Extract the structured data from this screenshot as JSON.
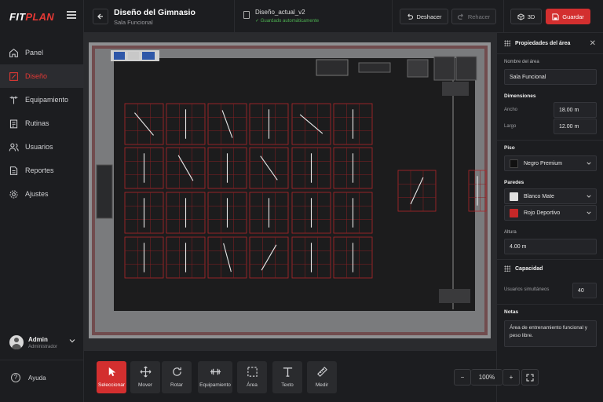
{
  "app": {
    "logo_a": "FIT",
    "logo_b": "PLAN"
  },
  "sidebar": {
    "items": [
      {
        "label": "Panel",
        "icon": "home-icon"
      },
      {
        "label": "Diseño",
        "icon": "design-icon"
      },
      {
        "label": "Equipamiento",
        "icon": "dumbbell-icon"
      },
      {
        "label": "Rutinas",
        "icon": "clipboard-icon"
      },
      {
        "label": "Usuarios",
        "icon": "users-icon"
      },
      {
        "label": "Reportes",
        "icon": "report-icon"
      },
      {
        "label": "Ajustes",
        "icon": "gear-icon"
      }
    ],
    "active": "Diseño",
    "user": {
      "name": "Admin",
      "role": "Administrador"
    },
    "help": "Ayuda"
  },
  "header": {
    "title": "Diseño del Gimnasio",
    "subtitle": "Sala Funcional",
    "file_name": "Diseño_actual_v2",
    "save_status": "Guardado automáticamente",
    "undo": "Deshacer",
    "redo": "Rehacer",
    "view3d": "3D",
    "save": "Guardar"
  },
  "props": {
    "title": "Propiedades del área",
    "name_label": "Nombre del área",
    "name_value": "Sala Funcional",
    "dimensions": "Dimensiones",
    "width_label": "Ancho",
    "width_value": "18.00 m",
    "length_label": "Largo",
    "length_value": "12.00 m",
    "floor": "Piso",
    "floor_value": "Negro Premium",
    "walls": "Paredes",
    "wall1": "Blanco Mate",
    "wall2": "Rojo Deportivo",
    "height_label": "Altura",
    "height_value": "4.00 m",
    "capacity": "Capacidad",
    "users_label": "Usuarios simultáneos",
    "users_value": "40",
    "notes_label": "Notas",
    "notes_value": "Área de entrenamiento funcional y peso libre."
  },
  "colors": {
    "accent": "#d32f2f",
    "floor": "#111111",
    "wall1": "#e0e0e0",
    "wall2": "#c62828"
  },
  "tools": [
    "Seleccionar",
    "Mover",
    "Rotar",
    "Equipamiento",
    "Área",
    "Texto",
    "Medir"
  ],
  "zoom": {
    "minus": "−",
    "value": "100%",
    "plus": "+"
  }
}
